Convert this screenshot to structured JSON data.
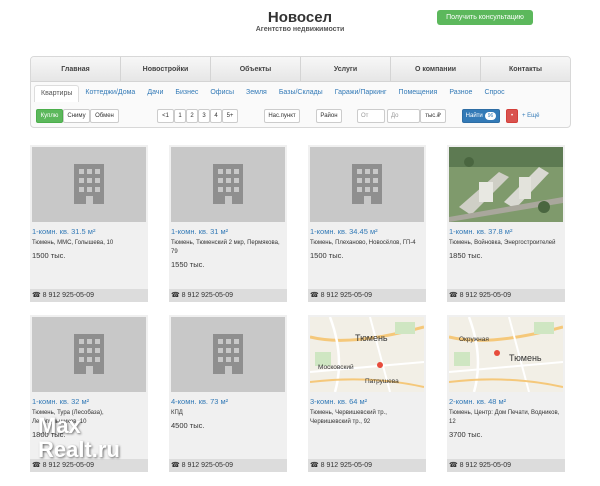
{
  "header": {
    "title": "Новосел",
    "subtitle": "Агентство недвижимости",
    "consult_label": "Получить консультацию"
  },
  "nav": [
    "Главная",
    "Новостройки",
    "Объекты",
    "Услуги",
    "О компании",
    "Контакты"
  ],
  "tabs": [
    "Квартиры",
    "Коттеджи/Дома",
    "Дачи",
    "Бизнес",
    "Офисы",
    "Земля",
    "Базы/Склады",
    "Гаражи/Паркинг",
    "Помещения",
    "Разное",
    "Спрос"
  ],
  "active_tab": "Квартиры",
  "filters": {
    "deal": [
      "Куплю",
      "Сниму",
      "Обмен"
    ],
    "rooms": [
      "<1",
      "1",
      "2",
      "3",
      "4",
      "5+"
    ],
    "locality": "Нас.пункт",
    "district": "Район",
    "price_from": "От",
    "price_to": "До",
    "currency": "тыс.₽",
    "find_label": "Найти",
    "find_count": "96",
    "more_label": "Ещё"
  },
  "listings": [
    {
      "title": "1-комн. кв. 31.5 м²",
      "address": "Тюмень, ММС, Голышева, 10",
      "price": "1500 тыс.",
      "phone": "8 912 925-05-09",
      "photo": "placeholder-building"
    },
    {
      "title": "1-комн. кв. 31 м²",
      "address": "Тюмень, Тюменский 2 мкр, Пермякова, 79",
      "price": "1550 тыс.",
      "phone": "8 912 925-05-09",
      "photo": "placeholder-building"
    },
    {
      "title": "1-комн. кв. 34.45 м²",
      "address": "Тюмень, Плеханово, Новосёлов, ГП-4",
      "price": "1500 тыс.",
      "phone": "8 912 925-05-09",
      "photo": "placeholder-building"
    },
    {
      "title": "1-комн. кв. 37.8 м²",
      "address": "Тюмень, Войновка, Энергостроителей",
      "price": "1850 тыс.",
      "phone": "8 912 925-05-09",
      "photo": "aerial-render"
    },
    {
      "title": "1-комн. кв. 32 м²",
      "address": "Тюмень, Тура (Лесобаза), Лесопильщиков, 10",
      "price": "1800 тыс.",
      "phone": "8 912 925-05-09",
      "photo": "placeholder-building"
    },
    {
      "title": "4-комн. кв. 73 м²",
      "address": "КПД",
      "price": "4500 тыс.",
      "phone": "8 912 925-05-09",
      "photo": "placeholder-building"
    },
    {
      "title": "3-комн. кв. 64 м²",
      "address": "Тюмень, Червишевский тр., Червишевский тр., 92",
      "price": "",
      "phone": "8 912 925-05-09",
      "photo": "map",
      "map_labels": [
        "Тюмень",
        "Московский",
        "Патрушева"
      ]
    },
    {
      "title": "2-комн. кв. 48 м²",
      "address": "Тюмень, Центр: Дом Печати, Водников, 12",
      "price": "3700 тыс.",
      "phone": "8 912 925-05-09",
      "photo": "map",
      "map_labels": [
        "Тюмень",
        "Окружная"
      ]
    }
  ],
  "watermark": {
    "line1": "Max",
    "line2": "Realt.ru"
  }
}
